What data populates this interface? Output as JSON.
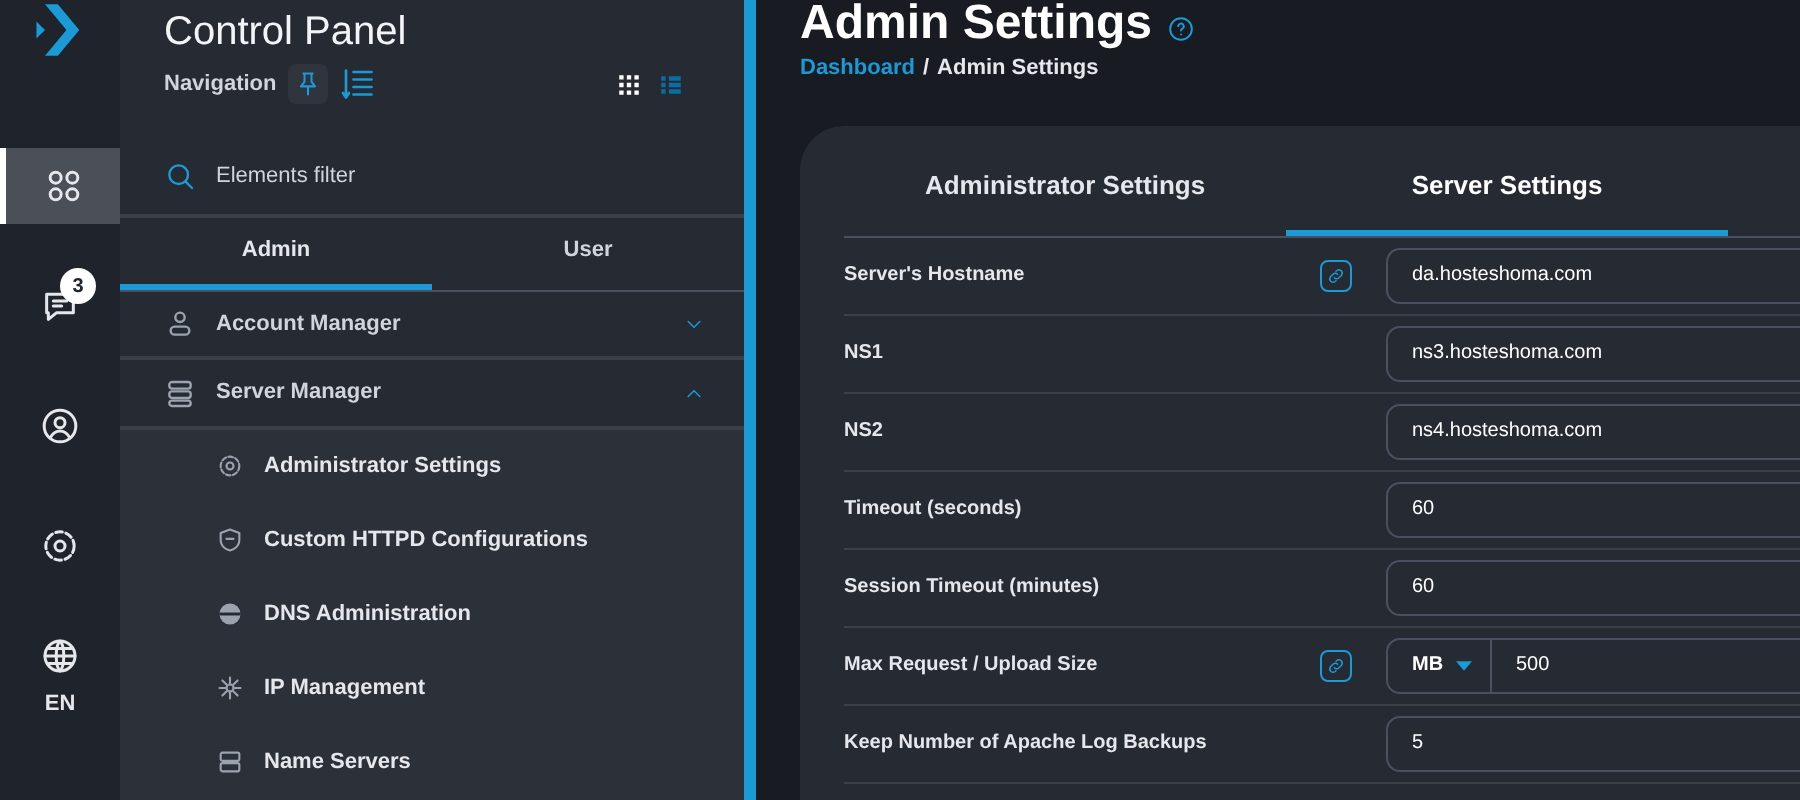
{
  "rail": {
    "items": [
      {
        "kind": "apps",
        "selected": true
      },
      {
        "kind": "chat",
        "selected": false,
        "badge": "3"
      },
      {
        "kind": "user",
        "selected": false
      },
      {
        "kind": "settings",
        "selected": false
      },
      {
        "kind": "language",
        "selected": false,
        "label": "EN"
      }
    ]
  },
  "sidebar": {
    "title": "Control Panel",
    "subtitle": "Navigation",
    "view_modes": [
      {
        "kind": "grid",
        "selected": false
      },
      {
        "kind": "list",
        "selected": true
      }
    ],
    "search": {
      "placeholder": "Elements filter"
    },
    "tabs": [
      {
        "label": "Admin",
        "selected": true
      },
      {
        "label": "User",
        "selected": false
      }
    ],
    "menu": [
      {
        "label": "Account Manager",
        "expanded": false
      },
      {
        "label": "Server Manager",
        "expanded": true,
        "children": [
          {
            "label": "Administrator Settings"
          },
          {
            "label": "Custom HTTPD Configurations"
          },
          {
            "label": "DNS Administration"
          },
          {
            "label": "IP Management"
          },
          {
            "label": "Name Servers"
          }
        ]
      }
    ]
  },
  "page": {
    "title": "Admin Settings",
    "breadcrumb": {
      "link": "Dashboard",
      "separator": "/",
      "current": "Admin Settings"
    }
  },
  "card": {
    "tabs": [
      {
        "label": "Administrator Settings",
        "selected": false
      },
      {
        "label": "Server Settings",
        "selected": true
      }
    ],
    "fields": [
      {
        "kind": "text",
        "label": "Server's Hostname",
        "linked": true,
        "value": "da.hosteshoma.com"
      },
      {
        "kind": "text",
        "label": "NS1",
        "linked": false,
        "value": "ns3.hosteshoma.com"
      },
      {
        "kind": "text",
        "label": "NS2",
        "linked": false,
        "value": "ns4.hosteshoma.com"
      },
      {
        "kind": "text",
        "label": "Timeout (seconds)",
        "linked": false,
        "value": "60"
      },
      {
        "kind": "text",
        "label": "Session Timeout (minutes)",
        "linked": false,
        "value": "60"
      },
      {
        "kind": "unit",
        "label": "Max Request / Upload Size",
        "linked": true,
        "unit": "MB",
        "value": "500"
      },
      {
        "kind": "text",
        "label": "Keep Number of Apache Log Backups",
        "linked": false,
        "value": "5"
      }
    ]
  }
}
